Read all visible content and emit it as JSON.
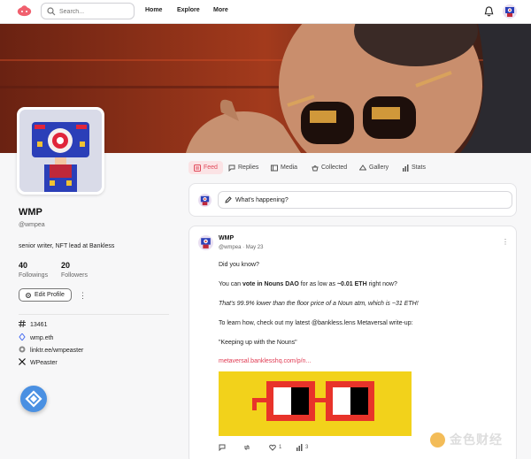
{
  "nav": {
    "search_placeholder": "Search...",
    "links": [
      "Home",
      "Explore",
      "More"
    ]
  },
  "profile": {
    "name": "WMP",
    "handle": "@wmpea",
    "bio": "senior writer, NFT lead at Bankless",
    "followings_count": "40",
    "followings_label": "Followings",
    "followers_count": "20",
    "followers_label": "Followers",
    "edit_label": "Edit Profile",
    "more": "⋮",
    "meta": [
      {
        "icon": "hash-icon",
        "text": "13461"
      },
      {
        "icon": "ens-icon",
        "text": "wmp.eth"
      },
      {
        "icon": "link-icon",
        "text": "linktr.ee/wmpeaster"
      },
      {
        "icon": "x-icon",
        "text": "WPeaster"
      }
    ]
  },
  "tabs": [
    "Feed",
    "Replies",
    "Media",
    "Collected",
    "Gallery",
    "Stats"
  ],
  "composer": {
    "placeholder": "What's happening?"
  },
  "post": {
    "name": "WMP",
    "handle": "@wmpea",
    "date": "May 23",
    "more": "⋮",
    "line1": "Did you know?",
    "line2_a": "You can ",
    "line2_b": "vote in Nouns DAO",
    "line2_c": " for as low as ",
    "line2_d": "~0.01 ETH",
    "line2_e": " right now?",
    "line3": "That's 99.9% lower than the floor price of a Noun atm, which is ~31 ETH!",
    "line4": "To learn how, check out my latest @bankless.lens Metaversal write-up:",
    "line5": "\"Keeping up with the Nouns\"",
    "link": "metaversal.banklesshq.com/p/n...",
    "actions": {
      "comment": "",
      "mirror": "",
      "likes": "1",
      "stats": "3"
    }
  },
  "colors": {
    "accent": "#e04a5a",
    "nouns_yellow": "#f2d21b",
    "nouns_red": "#e8332a"
  },
  "watermark": "金色财经"
}
